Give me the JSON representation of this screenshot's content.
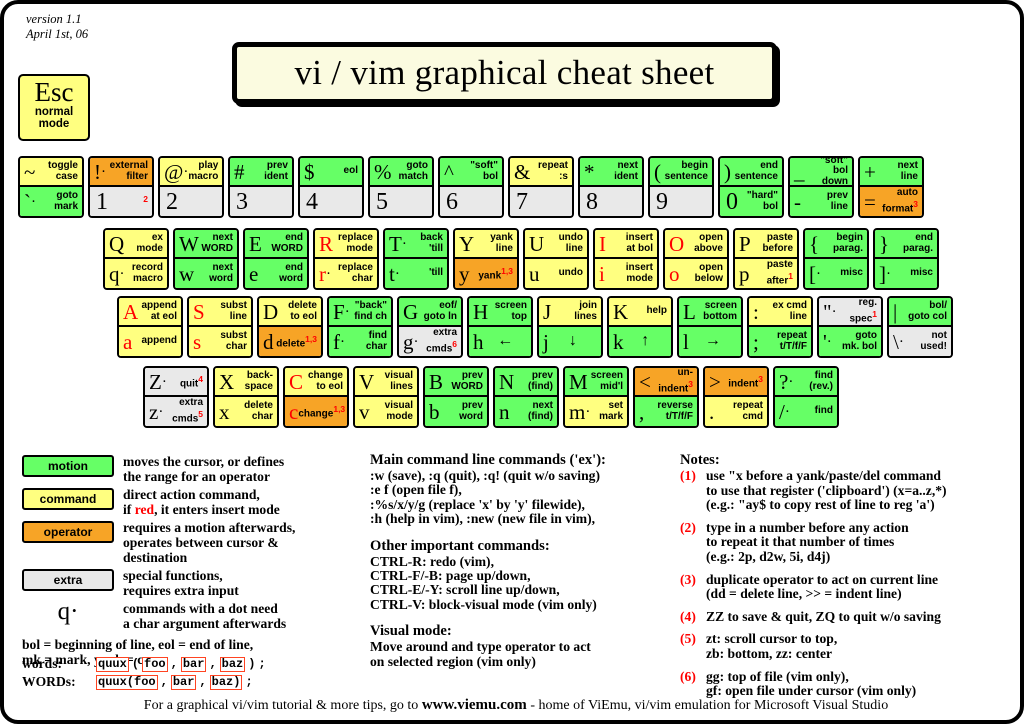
{
  "meta": {
    "version_line1": "version 1.1",
    "version_line2": "April 1st, 06"
  },
  "title": "vi / vim graphical cheat sheet",
  "esc": {
    "glyph": "Esc",
    "label": "normal\nmode"
  },
  "keyboard": {
    "row_numbers": [
      {
        "top": {
          "glyph": "~",
          "label": "toggle\ncase",
          "color": "yellow"
        },
        "bottom": {
          "glyph": "`",
          "dot": true,
          "label": "goto\nmark",
          "color": "green"
        }
      },
      {
        "top": {
          "glyph": "!",
          "dot": true,
          "label": "external\nfilter",
          "color": "orange"
        },
        "bottom": {
          "glyph": "1",
          "label": "",
          "color": "grey",
          "sup": "2"
        }
      },
      {
        "top": {
          "glyph": "@",
          "dot": true,
          "label": "play\nmacro",
          "color": "yellow"
        },
        "bottom": {
          "glyph": "2",
          "label": "",
          "color": "grey"
        }
      },
      {
        "top": {
          "glyph": "#",
          "label": "prev\nident",
          "color": "green"
        },
        "bottom": {
          "glyph": "3",
          "label": "",
          "color": "grey"
        }
      },
      {
        "top": {
          "glyph": "$",
          "label": "eol",
          "color": "green"
        },
        "bottom": {
          "glyph": "4",
          "label": "",
          "color": "grey"
        }
      },
      {
        "top": {
          "glyph": "%",
          "label": "goto\nmatch",
          "color": "green"
        },
        "bottom": {
          "glyph": "5",
          "label": "",
          "color": "grey"
        }
      },
      {
        "top": {
          "glyph": "^",
          "label": "\"soft\"\nbol",
          "color": "green"
        },
        "bottom": {
          "glyph": "6",
          "label": "",
          "color": "grey"
        }
      },
      {
        "top": {
          "glyph": "&",
          "label": "repeat\n:s",
          "color": "yellow"
        },
        "bottom": {
          "glyph": "7",
          "label": "",
          "color": "grey"
        }
      },
      {
        "top": {
          "glyph": "*",
          "label": "next\nident",
          "color": "green"
        },
        "bottom": {
          "glyph": "8",
          "label": "",
          "color": "grey"
        }
      },
      {
        "top": {
          "glyph": "(",
          "label": "begin\nsentence",
          "color": "green"
        },
        "bottom": {
          "glyph": "9",
          "label": "",
          "color": "grey"
        }
      },
      {
        "top": {
          "glyph": ")",
          "label": "end\nsentence",
          "color": "green"
        },
        "bottom": {
          "glyph": "0",
          "label": "\"hard\"\nbol",
          "color": "green"
        }
      },
      {
        "top": {
          "glyph": "_",
          "label": "\"soft\" bol\ndown",
          "color": "green"
        },
        "bottom": {
          "glyph": "-",
          "label": "prev\nline",
          "color": "green"
        }
      },
      {
        "top": {
          "glyph": "+",
          "label": "next\nline",
          "color": "green"
        },
        "bottom": {
          "glyph": "=",
          "label": "auto\nformat",
          "color": "orange",
          "sup": "3"
        }
      }
    ],
    "row_q": [
      {
        "top": {
          "glyph": "Q",
          "label": "ex\nmode",
          "color": "yellow"
        },
        "bottom": {
          "glyph": "q",
          "dot": true,
          "label": "record\nmacro",
          "color": "yellow"
        }
      },
      {
        "top": {
          "glyph": "W",
          "label": "next\nWORD",
          "color": "green"
        },
        "bottom": {
          "glyph": "w",
          "label": "next\nword",
          "color": "green"
        }
      },
      {
        "top": {
          "glyph": "E",
          "label": "end\nWORD",
          "color": "green"
        },
        "bottom": {
          "glyph": "e",
          "label": "end\nword",
          "color": "green"
        }
      },
      {
        "top": {
          "glyph": "R",
          "label": "replace\nmode",
          "color": "yellow",
          "red": true
        },
        "bottom": {
          "glyph": "r",
          "dot": true,
          "label": "replace\nchar",
          "color": "yellow",
          "red": true
        }
      },
      {
        "top": {
          "glyph": "T",
          "dot": true,
          "label": "back\n'till",
          "color": "green"
        },
        "bottom": {
          "glyph": "t",
          "dot": true,
          "label": "'till",
          "color": "green"
        }
      },
      {
        "top": {
          "glyph": "Y",
          "label": "yank\nline",
          "color": "yellow"
        },
        "bottom": {
          "glyph": "y",
          "label": "yank",
          "color": "orange",
          "sup": "1,3"
        }
      },
      {
        "top": {
          "glyph": "U",
          "label": "undo\nline",
          "color": "yellow"
        },
        "bottom": {
          "glyph": "u",
          "label": "undo",
          "color": "yellow"
        }
      },
      {
        "top": {
          "glyph": "I",
          "label": "insert\nat bol",
          "color": "yellow",
          "red": true
        },
        "bottom": {
          "glyph": "i",
          "label": "insert\nmode",
          "color": "yellow",
          "red": true
        }
      },
      {
        "top": {
          "glyph": "O",
          "label": "open\nabove",
          "color": "yellow",
          "red": true
        },
        "bottom": {
          "glyph": "o",
          "label": "open\nbelow",
          "color": "yellow",
          "red": true
        }
      },
      {
        "top": {
          "glyph": "P",
          "label": "paste\nbefore",
          "color": "yellow"
        },
        "bottom": {
          "glyph": "p",
          "label": "paste\nafter",
          "color": "yellow",
          "sup": "1"
        }
      },
      {
        "top": {
          "glyph": "{",
          "label": "begin\nparag.",
          "color": "green"
        },
        "bottom": {
          "glyph": "[",
          "dot": true,
          "label": "misc",
          "color": "green"
        }
      },
      {
        "top": {
          "glyph": "}",
          "label": "end\nparag.",
          "color": "green"
        },
        "bottom": {
          "glyph": "]",
          "dot": true,
          "label": "misc",
          "color": "green"
        }
      }
    ],
    "row_a": [
      {
        "top": {
          "glyph": "A",
          "label": "append\nat eol",
          "color": "yellow",
          "red": true
        },
        "bottom": {
          "glyph": "a",
          "label": "append",
          "color": "yellow",
          "red": true
        }
      },
      {
        "top": {
          "glyph": "S",
          "label": "subst\nline",
          "color": "yellow",
          "red": true
        },
        "bottom": {
          "glyph": "s",
          "label": "subst\nchar",
          "color": "yellow",
          "red": true
        }
      },
      {
        "top": {
          "glyph": "D",
          "label": "delete\nto eol",
          "color": "yellow"
        },
        "bottom": {
          "glyph": "d",
          "label": "delete",
          "color": "orange",
          "sup": "1,3"
        }
      },
      {
        "top": {
          "glyph": "F",
          "dot": true,
          "label": "\"back\"\nfind ch",
          "color": "green"
        },
        "bottom": {
          "glyph": "f",
          "dot": true,
          "label": "find\nchar",
          "color": "green"
        }
      },
      {
        "top": {
          "glyph": "G",
          "label": "eof/\ngoto ln",
          "color": "green"
        },
        "bottom": {
          "glyph": "g",
          "dot": true,
          "label": "extra\ncmds",
          "color": "grey",
          "sup": "6"
        }
      },
      {
        "top": {
          "glyph": "H",
          "label": "screen\ntop",
          "color": "green"
        },
        "bottom": {
          "glyph": "h",
          "label": "←",
          "color": "green",
          "arrow": true
        }
      },
      {
        "top": {
          "glyph": "J",
          "label": "join\nlines",
          "color": "yellow"
        },
        "bottom": {
          "glyph": "j",
          "label": "↓",
          "color": "green",
          "arrow": true
        }
      },
      {
        "top": {
          "glyph": "K",
          "label": "help",
          "color": "yellow"
        },
        "bottom": {
          "glyph": "k",
          "label": "↑",
          "color": "green",
          "arrow": true
        }
      },
      {
        "top": {
          "glyph": "L",
          "label": "screen\nbottom",
          "color": "green"
        },
        "bottom": {
          "glyph": "l",
          "label": "→",
          "color": "green",
          "arrow": true
        }
      },
      {
        "top": {
          "glyph": ":",
          "dotcol": true,
          "label": "ex cmd\nline",
          "color": "yellow"
        },
        "bottom": {
          "glyph": ";",
          "dotcol": true,
          "label": "repeat\nt/T/f/F",
          "color": "green"
        }
      },
      {
        "top": {
          "glyph": "\"",
          "dot": true,
          "label": "reg.\nspec",
          "color": "grey",
          "sup": "1"
        },
        "bottom": {
          "glyph": "'",
          "dot": true,
          "label": "goto\nmk. bol",
          "color": "green"
        }
      },
      {
        "top": {
          "glyph": "|",
          "label": "bol/\ngoto col",
          "color": "green"
        },
        "bottom": {
          "glyph": "\\",
          "dot": true,
          "label": "not\nused!",
          "color": "grey"
        }
      }
    ],
    "row_z": [
      {
        "top": {
          "glyph": "Z",
          "dot": true,
          "label": "quit",
          "color": "grey",
          "sup": "4"
        },
        "bottom": {
          "glyph": "z",
          "dot": true,
          "label": "extra\ncmds",
          "color": "grey",
          "sup": "5"
        }
      },
      {
        "top": {
          "glyph": "X",
          "label": "back-\nspace",
          "color": "yellow"
        },
        "bottom": {
          "glyph": "x",
          "label": "delete\nchar",
          "color": "yellow"
        }
      },
      {
        "top": {
          "glyph": "C",
          "label": "change\nto eol",
          "color": "yellow",
          "red": true
        },
        "bottom": {
          "glyph": "c",
          "label": "change",
          "color": "orange",
          "red": true,
          "sup": "1,3"
        }
      },
      {
        "top": {
          "glyph": "V",
          "label": "visual\nlines",
          "color": "yellow"
        },
        "bottom": {
          "glyph": "v",
          "label": "visual\nmode",
          "color": "yellow"
        }
      },
      {
        "top": {
          "glyph": "B",
          "label": "prev\nWORD",
          "color": "green"
        },
        "bottom": {
          "glyph": "b",
          "label": "prev\nword",
          "color": "green"
        }
      },
      {
        "top": {
          "glyph": "N",
          "label": "prev\n(find)",
          "color": "green"
        },
        "bottom": {
          "glyph": "n",
          "label": "next\n(find)",
          "color": "green"
        }
      },
      {
        "top": {
          "glyph": "M",
          "label": "screen\nmid'l",
          "color": "green"
        },
        "bottom": {
          "glyph": "m",
          "dot": true,
          "label": "set\nmark",
          "color": "yellow"
        }
      },
      {
        "top": {
          "glyph": "<",
          "label": "un-\nindent",
          "color": "orange",
          "sup": "3"
        },
        "bottom": {
          "glyph": ",",
          "label": "reverse\nt/T/f/F",
          "color": "green"
        }
      },
      {
        "top": {
          "glyph": ">",
          "label": "indent",
          "color": "orange",
          "sup": "3"
        },
        "bottom": {
          "glyph": ".",
          "label": "repeat\ncmd",
          "color": "yellow"
        }
      },
      {
        "top": {
          "glyph": "?",
          "dot": true,
          "label": "find\n(rev.)",
          "color": "green"
        },
        "bottom": {
          "glyph": "/",
          "dot": true,
          "label": "find",
          "color": "green"
        }
      }
    ]
  },
  "legend": {
    "items": [
      {
        "chip": "motion",
        "color": "green",
        "text": "moves the cursor, or defines\nthe range for an operator"
      },
      {
        "chip": "command",
        "color": "yellow",
        "text": "direct action command,"
      },
      {
        "chip": "operator",
        "color": "orange",
        "text": "requires a motion afterwards,\noperates between cursor  &\ndestination"
      },
      {
        "chip": "extra",
        "color": "grey",
        "text": "special functions,\nrequires extra input"
      }
    ],
    "command_line2_pre": "if ",
    "command_line2_red": "red",
    "command_line2_post": ", it enters insert mode",
    "dot_glyph": "q",
    "dot_text": "commands with a dot need\na char argument afterwards",
    "definitions": "bol = beginning of line, eol = end of line,\nmk = mark, yank = copy",
    "words_label": "words:",
    "words_tokens": [
      "quux",
      "(",
      "foo",
      ",",
      "bar",
      ",",
      "baz",
      ")",
      ";"
    ],
    "words_boxed": [
      true,
      false,
      true,
      false,
      true,
      false,
      true,
      false,
      false
    ],
    "WORDS_label": "WORDs:",
    "WORDS_tokens": [
      "quux(foo",
      ",",
      "bar",
      ",",
      "baz)",
      ";"
    ],
    "WORDS_boxed": [
      true,
      false,
      true,
      false,
      true,
      false
    ]
  },
  "main_commands": {
    "heading": "Main command line commands ('ex'):",
    "body": ":w (save), :q (quit), :q! (quit w/o saving)\n:e f (open file f),\n:%s/x/y/g (replace 'x' by 'y' filewide),\n:h (help in vim), :new (new file in vim),"
  },
  "other_commands": {
    "heading": "Other important commands:",
    "body": "CTRL-R: redo (vim),\nCTRL-F/-B: page up/down,\nCTRL-E/-Y: scroll line up/down,\nCTRL-V: block-visual mode (vim only)"
  },
  "visual_mode": {
    "heading": "Visual mode:",
    "body": "Move around and type operator to act\non selected region (vim only)"
  },
  "notes": {
    "heading": "Notes:",
    "items": [
      {
        "num": "(1)",
        "text": "use \"x before a yank/paste/del command\nto use that register ('clipboard') (x=a..z,*)\n(e.g.: \"ay$ to copy rest of line to reg 'a')"
      },
      {
        "num": "(2)",
        "text": "type in a number before any action\nto repeat it that number of times\n(e.g.: 2p, d2w, 5i, d4j)"
      },
      {
        "num": "(3)",
        "text": "duplicate operator to act on current line\n(dd = delete line, >> = indent line)"
      },
      {
        "num": "(4)",
        "text": "ZZ to save & quit, ZQ to quit w/o saving"
      },
      {
        "num": "(5)",
        "text": "zt: scroll cursor to top,\nzb: bottom, zz: center"
      },
      {
        "num": "(6)",
        "text": "gg: top of file (vim only),\ngf: open file under cursor (vim only)"
      }
    ]
  },
  "footer": {
    "pre": "For a graphical vi/vim tutorial & more tips, go to ",
    "site": "www.viemu.com",
    "post": " - home of ViEmu, vi/vim emulation for Microsoft Visual Studio"
  },
  "colors": {
    "motion": "#66ff66",
    "command": "#ffff80",
    "operator": "#f7a426",
    "extra": "#e9e9e9",
    "red": "#ff0000",
    "title_bg": "#fbfbe0"
  }
}
